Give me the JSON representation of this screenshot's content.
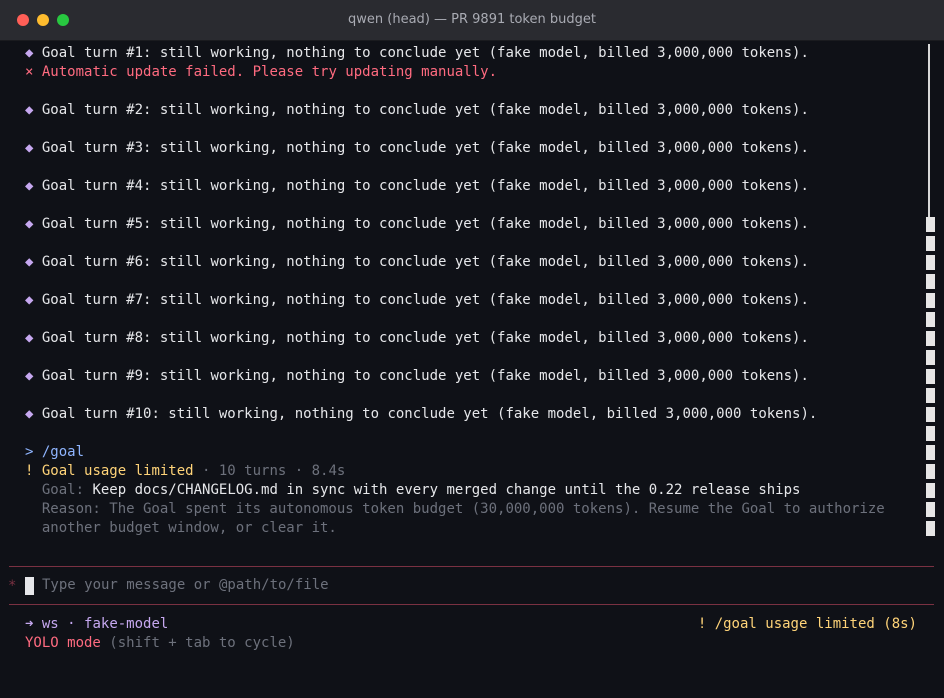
{
  "window": {
    "title": "qwen (head) — PR 9891 token budget"
  },
  "log": [
    {
      "type": "goal",
      "text": "Goal turn #1: still working, nothing to conclude yet (fake model, billed 3,000,000 tokens)."
    },
    {
      "type": "error",
      "text": "Automatic update failed. Please try updating manually."
    },
    {
      "type": "goal",
      "text": "Goal turn #2: still working, nothing to conclude yet (fake model, billed 3,000,000 tokens)."
    },
    {
      "type": "goal",
      "text": "Goal turn #3: still working, nothing to conclude yet (fake model, billed 3,000,000 tokens)."
    },
    {
      "type": "goal",
      "text": "Goal turn #4: still working, nothing to conclude yet (fake model, billed 3,000,000 tokens)."
    },
    {
      "type": "goal",
      "text": "Goal turn #5: still working, nothing to conclude yet (fake model, billed 3,000,000 tokens)."
    },
    {
      "type": "goal",
      "text": "Goal turn #6: still working, nothing to conclude yet (fake model, billed 3,000,000 tokens)."
    },
    {
      "type": "goal",
      "text": "Goal turn #7: still working, nothing to conclude yet (fake model, billed 3,000,000 tokens)."
    },
    {
      "type": "goal",
      "text": "Goal turn #8: still working, nothing to conclude yet (fake model, billed 3,000,000 tokens)."
    },
    {
      "type": "goal",
      "text": "Goal turn #9: still working, nothing to conclude yet (fake model, billed 3,000,000 tokens)."
    },
    {
      "type": "goal",
      "text": "Goal turn #10: still working, nothing to conclude yet (fake model, billed 3,000,000 tokens)."
    }
  ],
  "icons": {
    "goal_marker": "◆",
    "error_marker": "×",
    "prompt_marker": ">",
    "warn_marker": "!",
    "input_marker": "*",
    "branch_arrow": "➜"
  },
  "command": {
    "text": "/goal"
  },
  "result": {
    "title": "Goal usage limited",
    "meta": " · 10 turns · 8.4s",
    "goal_label": "Goal:",
    "goal_text": "Keep docs/CHANGELOG.md in sync with every merged change until the 0.22 release ships",
    "reason_line1": "Reason: The Goal spent its autonomous token budget (30,000,000 tokens). Resume the Goal to authorize",
    "reason_line2": "another budget window, or clear it."
  },
  "input": {
    "placeholder": "Type your message or @path/to/file"
  },
  "status": {
    "workspace": "ws",
    "separator": " · ",
    "model": "fake-model",
    "right": "! /goal usage limited (8s)",
    "mode": "YOLO mode",
    "mode_hint": "(shift + tab to cycle)"
  },
  "colors": {
    "background": "#0f1117",
    "goal_diamond": "#c6a8f0",
    "error": "#ff6b80",
    "warning": "#ffd479",
    "prompt": "#8fb5ff",
    "dim": "#6d717c",
    "separator": "#7a3142"
  }
}
